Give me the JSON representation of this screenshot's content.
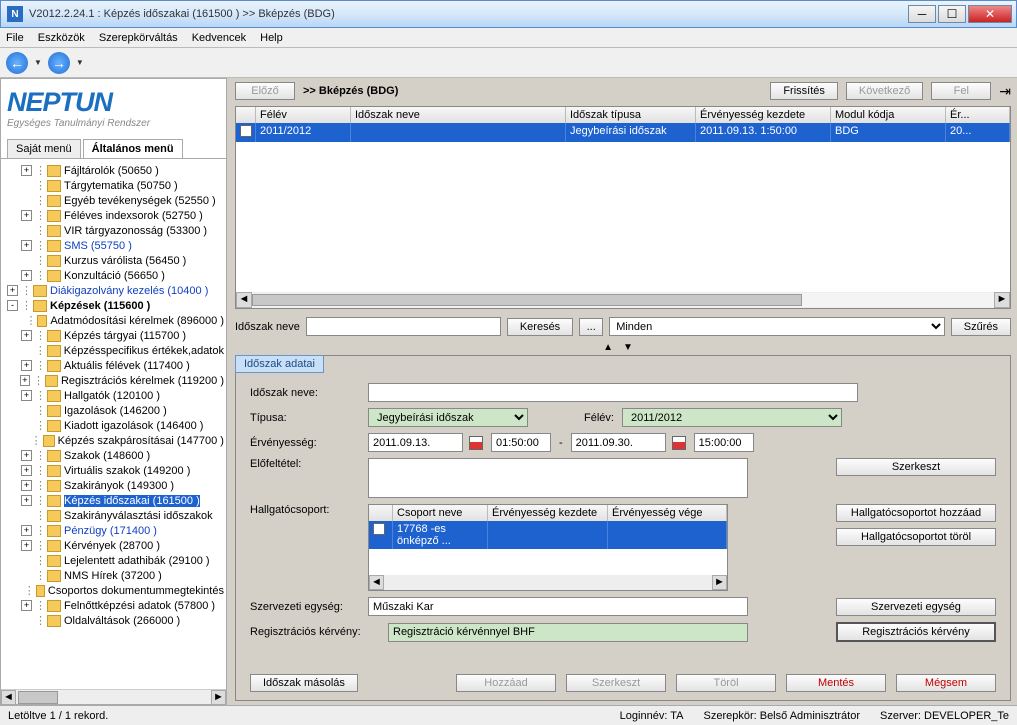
{
  "titlebar": "V2012.2.24.1 : Képzés időszakai (161500  )  >> Bképzés (BDG)",
  "menu": [
    "File",
    "Eszközök",
    "Szerepkörváltás",
    "Kedvencek",
    "Help"
  ],
  "logo": {
    "main": "NEPTUN",
    "sub": "Egységes Tanulmányi Rendszer"
  },
  "left_tabs": {
    "own": "Saját menü",
    "general": "Általános menü"
  },
  "tree": [
    {
      "t": "Fájltárolók (50650  )",
      "box": "+",
      "ind": 1
    },
    {
      "t": "Tárgytematika (50750  )",
      "box": "",
      "ind": 1
    },
    {
      "t": "Egyéb tevékenységek (52550  )",
      "box": "",
      "ind": 1
    },
    {
      "t": "Féléves indexsorok (52750  )",
      "box": "+",
      "ind": 1
    },
    {
      "t": "VIR tárgyazonosság (53300  )",
      "box": "",
      "ind": 1
    },
    {
      "t": "SMS (55750  )",
      "box": "+",
      "ind": 1,
      "blue": true
    },
    {
      "t": "Kurzus várólista (56450  )",
      "box": "",
      "ind": 1
    },
    {
      "t": "Konzultáció (56650  )",
      "box": "+",
      "ind": 1
    },
    {
      "t": "Diákigazolvány kezelés (10400  )",
      "box": "+",
      "ind": 0,
      "blue": true
    },
    {
      "t": "Képzések (115600  )",
      "box": "-",
      "ind": 0,
      "bold": true
    },
    {
      "t": "Adatmódosítási kérelmek (896000  )",
      "box": "",
      "ind": 1
    },
    {
      "t": "Képzés tárgyai (115700  )",
      "box": "+",
      "ind": 1
    },
    {
      "t": "Képzésspecifikus értékek,adatok",
      "box": "",
      "ind": 1
    },
    {
      "t": "Aktuális félévek (117400  )",
      "box": "+",
      "ind": 1
    },
    {
      "t": "Regisztrációs kérelmek (119200  )",
      "box": "+",
      "ind": 1
    },
    {
      "t": "Hallgatók (120100  )",
      "box": "+",
      "ind": 1
    },
    {
      "t": "Igazolások (146200  )",
      "box": "",
      "ind": 1
    },
    {
      "t": "Kiadott igazolások (146400  )",
      "box": "",
      "ind": 1
    },
    {
      "t": "Képzés szakpárosításai (147700  )",
      "box": "",
      "ind": 1
    },
    {
      "t": "Szakok (148600  )",
      "box": "+",
      "ind": 1
    },
    {
      "t": "Virtuális szakok (149200  )",
      "box": "+",
      "ind": 1
    },
    {
      "t": "Szakirányok (149300  )",
      "box": "+",
      "ind": 1
    },
    {
      "t": "Képzés időszakai (161500  )",
      "box": "+",
      "ind": 1,
      "sel": true
    },
    {
      "t": "Szakirányválasztási időszakok",
      "box": "",
      "ind": 1
    },
    {
      "t": "Pénzügy (171400  )",
      "box": "+",
      "ind": 1,
      "blue": true
    },
    {
      "t": "Kérvények (28700  )",
      "box": "+",
      "ind": 1
    },
    {
      "t": "Lejelentett adathibák (29100  )",
      "box": "",
      "ind": 1
    },
    {
      "t": "NMS Hírek (37200  )",
      "box": "",
      "ind": 1
    },
    {
      "t": "Csoportos dokumentummegtekintés",
      "box": "",
      "ind": 1
    },
    {
      "t": "Felnőttképzési adatok (57800  )",
      "box": "+",
      "ind": 1
    },
    {
      "t": "Oldalváltások (266000  )",
      "box": "",
      "ind": 1
    }
  ],
  "toolbar": {
    "prev": "Előző",
    "breadcrumb": ">> Bképzés (BDG)",
    "refresh": "Frissítés",
    "next": "Következő",
    "up": "Fel"
  },
  "grid": {
    "cols": [
      "",
      "Félév",
      "Időszak neve",
      "Időszak típusa",
      "Érvényesség kezdete",
      "Modul kódja",
      "Ér..."
    ],
    "row": [
      "",
      "2011/2012",
      "",
      "Jegybeírási időszak",
      "2011.09.13. 1:50:00",
      "BDG",
      "20..."
    ]
  },
  "search": {
    "label": "Időszak neve",
    "btn": "Keresés",
    "dots": "...",
    "all": "Minden",
    "filter": "Szűrés"
  },
  "panel": {
    "tab": "Időszak adatai",
    "name_label": "Időszak neve:",
    "type_label": "Típusa:",
    "type_value": "Jegybeírási időszak",
    "sem_label": "Félév:",
    "sem_value": "2011/2012",
    "valid_label": "Érvényesség:",
    "date_from": "2011.09.13.",
    "time_from": "01:50:00",
    "dash": "-",
    "date_to": "2011.09.30.",
    "time_to": "15:00:00",
    "precond_label": "Előfeltétel:",
    "group_label": "Hallgatócsoport:",
    "group_cols": [
      "",
      "Csoport neve",
      "Érvényesség kezdete",
      "Érvényesség vége"
    ],
    "group_row": "17768 -es önképző ...",
    "org_label": "Szervezeti egység:",
    "org_value": "Műszaki Kar",
    "reg_label": "Regisztrációs kérvény:",
    "reg_value": "Regisztráció kérvénnyel BHF",
    "btn_edit": "Szerkeszt",
    "btn_add_group": "Hallgatócsoportot hozzáad",
    "btn_del_group": "Hallgatócsoportot töröl",
    "btn_org": "Szervezeti egység",
    "btn_reg": "Regisztrációs kérvény"
  },
  "bottom": {
    "copy": "Időszak másolás",
    "add": "Hozzáad",
    "edit": "Szerkeszt",
    "del": "Töröl",
    "save": "Mentés",
    "cancel": "Mégsem"
  },
  "status": {
    "records": "Letöltve 1 / 1 rekord.",
    "login": "Loginnév: TA",
    "role": "Szerepkör: Belső Adminisztrátor",
    "server": "Szerver: DEVELOPER_Te"
  }
}
